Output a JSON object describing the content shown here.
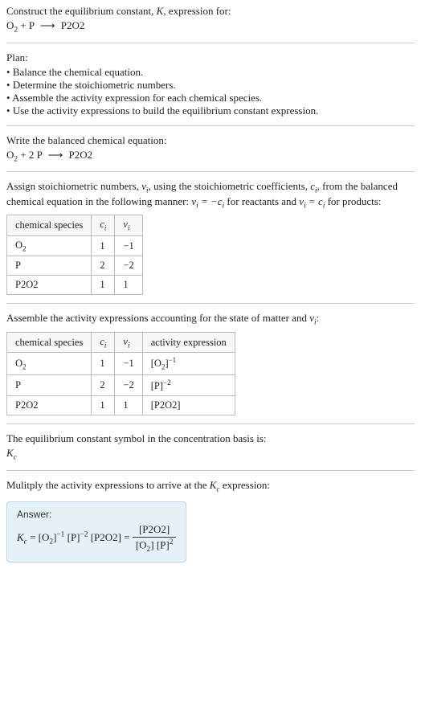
{
  "intro": {
    "line1": "Construct the equilibrium constant, ",
    "K": "K",
    "line1b": ", expression for:",
    "eq_lhs_a": "O",
    "eq_lhs_a_sub": "2",
    "plus": " + ",
    "eq_lhs_b": "P",
    "arrow": "⟶",
    "eq_rhs": "P2O2"
  },
  "plan": {
    "heading": "Plan:",
    "items": [
      "Balance the chemical equation.",
      "Determine the stoichiometric numbers.",
      "Assemble the activity expression for each chemical species.",
      "Use the activity expressions to build the equilibrium constant expression."
    ]
  },
  "balanced": {
    "heading": "Write the balanced chemical equation:",
    "o2": "O",
    "o2_sub": "2",
    "plus": " + ",
    "coef_p": "2 ",
    "p": "P",
    "arrow": "⟶",
    "rhs": "P2O2"
  },
  "assign": {
    "text_a": "Assign stoichiometric numbers, ",
    "nu_i": "ν",
    "i": "i",
    "text_b": ", using the stoichiometric coefficients, ",
    "c_i": "c",
    "text_c": ", from the balanced chemical equation in the following manner: ",
    "rel_react_a": "ν",
    "rel_react_b": " = −",
    "rel_react_c": "c",
    "text_d": " for reactants and ",
    "rel_prod_a": "ν",
    "rel_prod_b": " = ",
    "rel_prod_c": "c",
    "text_e": " for products:"
  },
  "table1": {
    "headers": {
      "species": "chemical species",
      "c": "c",
      "c_sub": "i",
      "nu": "ν",
      "nu_sub": "i"
    },
    "rows": [
      {
        "species_a": "O",
        "species_sub": "2",
        "c": "1",
        "nu": "−1"
      },
      {
        "species_a": "P",
        "species_sub": "",
        "c": "2",
        "nu": "−2"
      },
      {
        "species_a": "P2O2",
        "species_sub": "",
        "c": "1",
        "nu": "1"
      }
    ]
  },
  "assemble": {
    "text_a": "Assemble the activity expressions accounting for the state of matter and ",
    "nu": "ν",
    "i": "i",
    "text_b": ":"
  },
  "table2": {
    "headers": {
      "species": "chemical species",
      "c": "c",
      "c_sub": "i",
      "nu": "ν",
      "nu_sub": "i",
      "act": "activity expression"
    },
    "rows": [
      {
        "species_a": "O",
        "species_sub": "2",
        "c": "1",
        "nu": "−1",
        "act_base": "[O",
        "act_sub": "2",
        "act_close": "]",
        "act_exp": "−1"
      },
      {
        "species_a": "P",
        "species_sub": "",
        "c": "2",
        "nu": "−2",
        "act_base": "[P",
        "act_sub": "",
        "act_close": "]",
        "act_exp": "−2"
      },
      {
        "species_a": "P2O2",
        "species_sub": "",
        "c": "1",
        "nu": "1",
        "act_base": "[P2O2]",
        "act_sub": "",
        "act_close": "",
        "act_exp": ""
      }
    ]
  },
  "basis": {
    "heading": "The equilibrium constant symbol in the concentration basis is:",
    "K": "K",
    "c": "c"
  },
  "multiply": {
    "text_a": "Mulitply the activity expressions to arrive at the ",
    "K": "K",
    "c": "c",
    "text_b": " expression:"
  },
  "answer": {
    "label": "Answer:",
    "Kc_K": "K",
    "Kc_c": "c",
    "eq": " = ",
    "t1_base": "[O",
    "t1_sub": "2",
    "t1_close": "]",
    "t1_exp": "−1",
    "t2_base": " [P]",
    "t2_exp": "−2",
    "t3": " [P2O2]",
    "eq2": " = ",
    "frac_num": "[P2O2]",
    "frac_den_a": "[O",
    "frac_den_a_sub": "2",
    "frac_den_a_close": "] ",
    "frac_den_b": "[P]",
    "frac_den_b_exp": "2"
  },
  "chart_data": {
    "type": "table",
    "tables": [
      {
        "title": "Stoichiometric numbers",
        "columns": [
          "chemical species",
          "c_i",
          "nu_i"
        ],
        "rows": [
          [
            "O2",
            1,
            -1
          ],
          [
            "P",
            2,
            -2
          ],
          [
            "P2O2",
            1,
            1
          ]
        ]
      },
      {
        "title": "Activity expressions",
        "columns": [
          "chemical species",
          "c_i",
          "nu_i",
          "activity expression"
        ],
        "rows": [
          [
            "O2",
            1,
            -1,
            "[O2]^-1"
          ],
          [
            "P",
            2,
            -2,
            "[P]^-2"
          ],
          [
            "P2O2",
            1,
            1,
            "[P2O2]"
          ]
        ]
      }
    ]
  }
}
